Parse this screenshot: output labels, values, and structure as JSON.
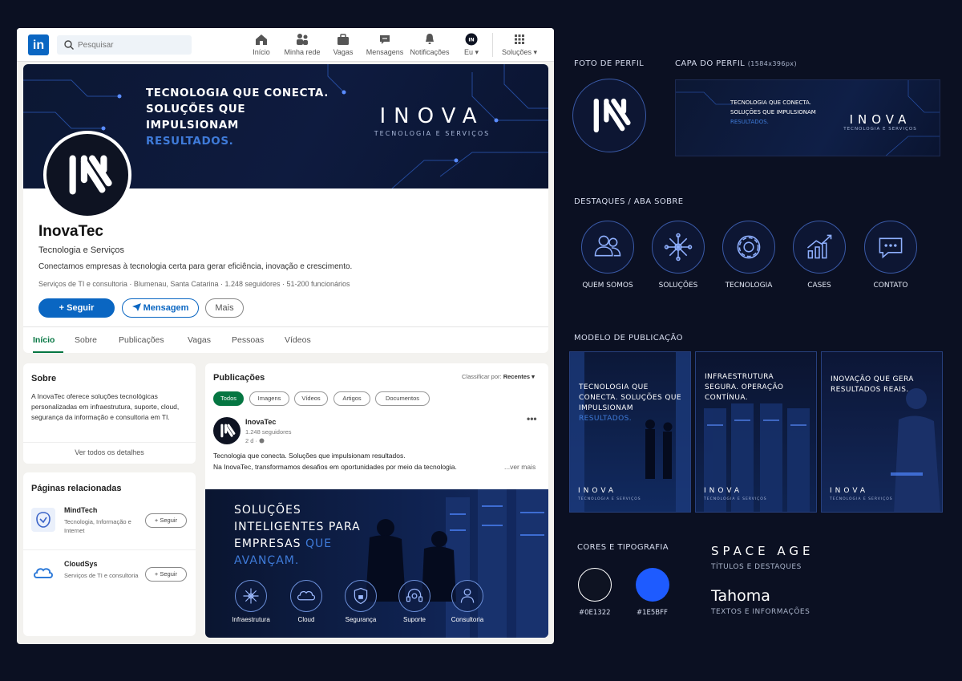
{
  "colors": {
    "page_background": "#0b1022",
    "linkedin_blue": "#0a66c2",
    "linkedin_green": "#057642",
    "brand_dark": "#0E1322",
    "brand_blue": "#1E5BFF"
  },
  "linkedin": {
    "logo_text": "in",
    "search": {
      "placeholder": "Pesquisar",
      "value": ""
    },
    "nav": [
      {
        "label": "Início",
        "icon": "home-icon"
      },
      {
        "label": "Minha rede",
        "icon": "network-icon"
      },
      {
        "label": "Vagas",
        "icon": "briefcase-icon"
      },
      {
        "label": "Mensagens",
        "icon": "message-icon"
      },
      {
        "label": "Notificações",
        "icon": "bell-icon"
      },
      {
        "label": "Eu ▾",
        "icon": "profile-avatar-icon"
      },
      {
        "label": "Soluções ▾",
        "icon": "grid-icon"
      }
    ],
    "cover": {
      "headline_part1": "TECNOLOGIA QUE CONECTA. SOLUÇÕES QUE IMPULSIONAM ",
      "headline_accent": "RESULTADOS.",
      "brand": "INOVA",
      "brand_sub": "TECNOLOGIA E SERVIÇOS"
    },
    "profile": {
      "name": "InovaTec",
      "tagline": "Tecnologia e Serviços",
      "description": "Conectamos empresas à tecnologia certa para gerar eficiência, inovação e crescimento.",
      "meta": "Serviços de TI e consultoria · Blumenau, Santa Catarina · 1.248 seguidores · 51-200 funcionários",
      "follow_label": "+ Seguir",
      "message_label": "Mensagem",
      "more_label": "Mais"
    },
    "tabs": [
      "Início",
      "Sobre",
      "Publicações",
      "Vagas",
      "Pessoas",
      "Vídeos"
    ],
    "about": {
      "title": "Sobre",
      "text": "A InovaTec oferece soluções tecnológicas personalizadas em infraestrutura, suporte, cloud, segurança da informação e consultoria em TI.",
      "link": "Ver todos os detalhes"
    },
    "related": {
      "title": "Páginas relacionadas",
      "items": [
        {
          "name": "MindTech",
          "desc": "Tecnologia, Informação e Internet",
          "follow": "+ Seguir"
        },
        {
          "name": "CloudSys",
          "desc": "Serviços de TI e consultoria",
          "follow": "+ Seguir"
        }
      ]
    },
    "posts": {
      "title": "Publicações",
      "sort_label": "Classificar por:",
      "sort_value": "Recentes ▾",
      "filters": [
        "Todos",
        "Imagens",
        "Vídeos",
        "Artigos",
        "Documentos"
      ],
      "post": {
        "author": "InovaTec",
        "followers": "1.248 seguidores",
        "time": "2 d ·",
        "line1": "Tecnologia que conecta. Soluções que impulsionam resultados.",
        "line2": "Na InovaTec, transformamos desafios em oportunidades por meio da tecnologia.",
        "more": "...ver mais",
        "image_text": "SOLUÇÕES INTELIGENTES PARA EMPRESAS ",
        "image_accent": "QUE AVANÇAM.",
        "services": [
          "Infraestrutura",
          "Cloud",
          "Segurança",
          "Suporte",
          "Consultoria"
        ]
      }
    }
  },
  "kit": {
    "profile_photo_title": "FOTO DE PERFIL",
    "cover_title": "CAPA DO PERFIL",
    "cover_size": "(1584x396px)",
    "cover_text": "TECNOLOGIA QUE CONECTA. SOLUÇÕES QUE IMPULSIONAM ",
    "cover_accent": "RESULTADOS.",
    "cover_brand": "INOVA",
    "cover_brand_sub": "TECNOLOGIA E SERVIÇOS",
    "highlights_title": "DESTAQUES / ABA SOBRE",
    "highlights": [
      "QUEM SOMOS",
      "SOLUÇÕES",
      "TECNOLOGIA",
      "CASES",
      "CONTATO"
    ],
    "templates_title": "MODELO DE PUBLICAÇÃO",
    "templates": [
      {
        "text": "TECNOLOGIA QUE CONECTA. SOLUÇÕES QUE IMPULSIONAM ",
        "accent": "RESULTADOS."
      },
      {
        "text": "INFRAESTRUTURA SEGURA. OPERAÇÃO CONTÍNUA.",
        "accent": ""
      },
      {
        "text": "INOVAÇÃO QUE GERA RESULTADOS REAIS.",
        "accent": ""
      }
    ],
    "template_brand": "INOVA",
    "template_brand_sub": "TECNOLOGIA E SERVIÇOS",
    "colors_title": "CORES E TIPOGRAFIA",
    "swatches": [
      "#0E1322",
      "#1E5BFF"
    ],
    "font_display": "SPACE AGE",
    "font_display_use": "TÍTULOS E DESTAQUES",
    "font_body": "Tahoma",
    "font_body_use": "TEXTOS E INFORMAÇÕES"
  }
}
